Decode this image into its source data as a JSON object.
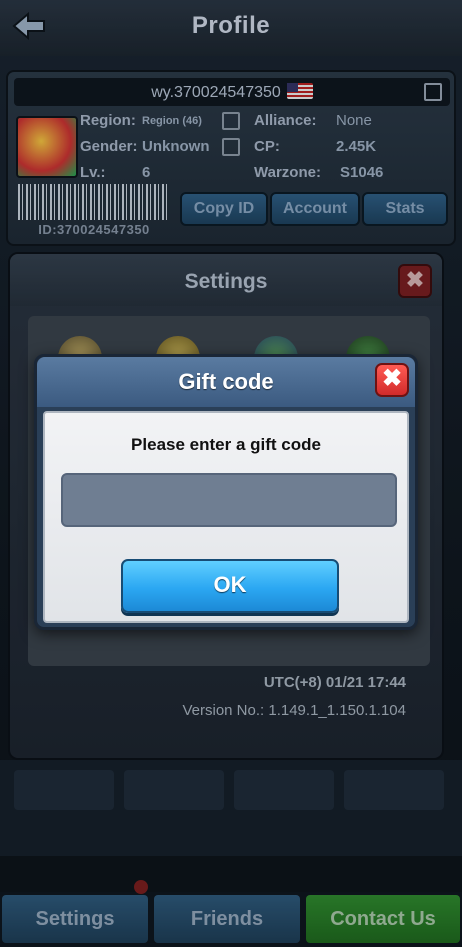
{
  "top_bar": {
    "title": "Profile"
  },
  "profile": {
    "username": "wy.370024547350",
    "labels": {
      "region": "Region:",
      "gender": "Gender:",
      "level": "Lv.:",
      "alliance": "Alliance:",
      "cp": "CP:",
      "warzone": "Warzone:"
    },
    "values": {
      "region": "Region (46)",
      "gender": "Unknown",
      "level": "6",
      "alliance": "None",
      "cp": "2.45K",
      "warzone": "S1046"
    },
    "id_text": "ID:370024547350",
    "buttons": {
      "copy_id": "Copy ID",
      "account": "Account",
      "stats": "Stats"
    }
  },
  "settings": {
    "title": "Settings",
    "close_label": "✖",
    "timestamp": "UTC(+8) 01/21 17:44",
    "version": "Version No.: 1.149.1_1.150.1.104"
  },
  "bottom_nav": {
    "settings": "Settings",
    "friends": "Friends",
    "contact_us": "Contact Us"
  },
  "gift_modal": {
    "title": "Gift code",
    "close_label": "✖",
    "prompt": "Please enter a gift code",
    "input_value": "",
    "ok_label": "OK"
  },
  "colors": {
    "ok_button": "#2ba7f2",
    "close_button": "#d22b2b",
    "modal_header": "#4a6a90",
    "contact_us": "#1f7a1f"
  },
  "icons": [
    "back-arrow-icon",
    "flag-us-icon",
    "edit-icon",
    "close-icon"
  ]
}
